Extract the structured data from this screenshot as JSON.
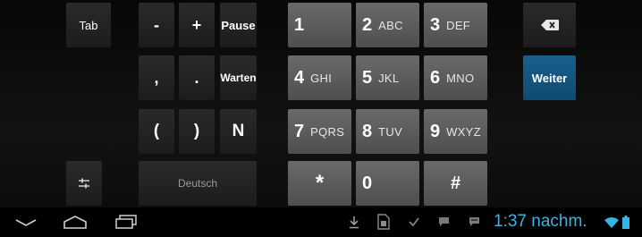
{
  "keys": {
    "tab": "Tab",
    "minus": "-",
    "plus": "+",
    "pause": "Pause",
    "comma": ",",
    "period": ".",
    "wait": "Warten",
    "paren_open": "(",
    "paren_close": ")",
    "n": "N",
    "language": "Deutsch",
    "next": "Weiter",
    "num1": {
      "digit": "1",
      "letters": ""
    },
    "num2": {
      "digit": "2",
      "letters": "ABC"
    },
    "num3": {
      "digit": "3",
      "letters": "DEF"
    },
    "num4": {
      "digit": "4",
      "letters": "GHI"
    },
    "num5": {
      "digit": "5",
      "letters": "JKL"
    },
    "num6": {
      "digit": "6",
      "letters": "MNO"
    },
    "num7": {
      "digit": "7",
      "letters": "PQRS"
    },
    "num8": {
      "digit": "8",
      "letters": "TUV"
    },
    "num9": {
      "digit": "9",
      "letters": "WXYZ"
    },
    "star": "*",
    "num0": "0",
    "hash": "#"
  },
  "icons": {
    "backspace": "backspace-icon",
    "settings": "settings-sliders-icon",
    "hide_keyboard": "chevron-down-icon",
    "home": "home-icon",
    "recents": "recent-apps-icon",
    "download": "download-icon",
    "sim": "sim-card-icon",
    "checkbox": "checkbox-icon",
    "chat1": "chat-icon",
    "chat2": "message-icon",
    "wifi": "wifi-icon",
    "battery": "battery-icon"
  },
  "status": {
    "time": "1:37 nachm."
  },
  "colors": {
    "accent": "#33b5e5",
    "next_key": "#125a87"
  }
}
